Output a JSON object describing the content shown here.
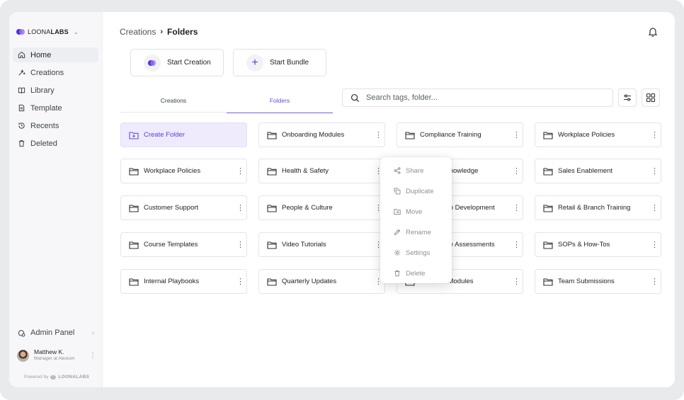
{
  "brand": {
    "name_light": "LOONA",
    "name_bold": "LABS"
  },
  "sidebar": {
    "items": [
      {
        "label": "Home",
        "icon": "home-icon"
      },
      {
        "label": "Creations",
        "icon": "wand-icon"
      },
      {
        "label": "Library",
        "icon": "book-icon"
      },
      {
        "label": "Template",
        "icon": "document-icon"
      },
      {
        "label": "Recents",
        "icon": "history-icon"
      },
      {
        "label": "Deleted",
        "icon": "trash-icon"
      }
    ],
    "admin_panel": "Admin Panel",
    "user": {
      "name": "Matthew K.",
      "role": "Manager at Alexium"
    },
    "powered_by": "Powered by",
    "powered_brand": "LOONALABS"
  },
  "breadcrumb": {
    "root": "Creations",
    "current": "Folders"
  },
  "actions": {
    "start_creation": "Start Creation",
    "start_bundle": "Start Bundle"
  },
  "tabs": [
    {
      "label": "Creations"
    },
    {
      "label": "Folders"
    }
  ],
  "active_tab": "Folders",
  "search": {
    "placeholder": "Search tags, folder...",
    "value": ""
  },
  "folders": {
    "create_label": "Create Folder",
    "items": [
      "Onboarding Modules",
      "Compliance Training",
      "Workplace Policies",
      "Workplace Policies",
      "Health & Safety",
      "Product Knowledge",
      "Sales Enablement",
      "Customer Support",
      "People & Culture",
      "Leadership Development",
      "Retail & Branch Training",
      "Course Templates",
      "Video Tutorials",
      "Knowledge Assessments",
      "SOPs & How-Tos",
      "Internal Playbooks",
      "Quarterly Updates",
      "Archived Modules",
      "Team Submissions"
    ]
  },
  "context_menu": {
    "items": [
      {
        "label": "Share",
        "icon": "share-icon"
      },
      {
        "label": "Duplicate",
        "icon": "duplicate-icon"
      },
      {
        "label": "Move",
        "icon": "move-folder-icon"
      },
      {
        "label": "Rename",
        "icon": "pencil-icon"
      },
      {
        "label": "Settings",
        "icon": "gear-icon"
      },
      {
        "label": "Delete",
        "icon": "trash-icon"
      }
    ]
  },
  "colors": {
    "accent": "#5b3ee0",
    "accent_light": "#f0ebfc",
    "sidebar_bg": "#f7f7f9"
  }
}
